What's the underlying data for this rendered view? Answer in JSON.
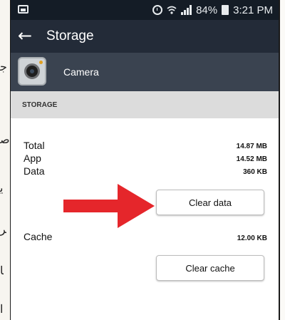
{
  "status_bar": {
    "battery_percent": "84%",
    "time": "3:21 PM"
  },
  "app_bar": {
    "title": "Storage"
  },
  "app_header": {
    "app_name": "Camera"
  },
  "storage": {
    "section_title": "STORAGE",
    "rows": [
      {
        "label": "Total",
        "value": "14.87 MB"
      },
      {
        "label": "App",
        "value": "14.52 MB"
      },
      {
        "label": "Data",
        "value": "360 KB"
      }
    ],
    "clear_data_label": "Clear data",
    "cache_label": "Cache",
    "cache_value": "12.00 KB",
    "clear_cache_label": "Clear cache"
  },
  "colors": {
    "status_bar_bg": "#141c26",
    "app_bar_bg": "#232b38",
    "app_header_bg": "#3a4350",
    "section_header_bg": "#dcdcdc",
    "annotation_arrow": "#e5262b"
  },
  "icons": {
    "status_left": "screenshot-icon",
    "alarm": "alarm-icon",
    "wifi": "wifi-icon",
    "signal": "signal-icon",
    "battery": "battery-icon",
    "back": "back-arrow-icon",
    "app": "camera-icon",
    "annotation": "red-arrow-icon"
  }
}
